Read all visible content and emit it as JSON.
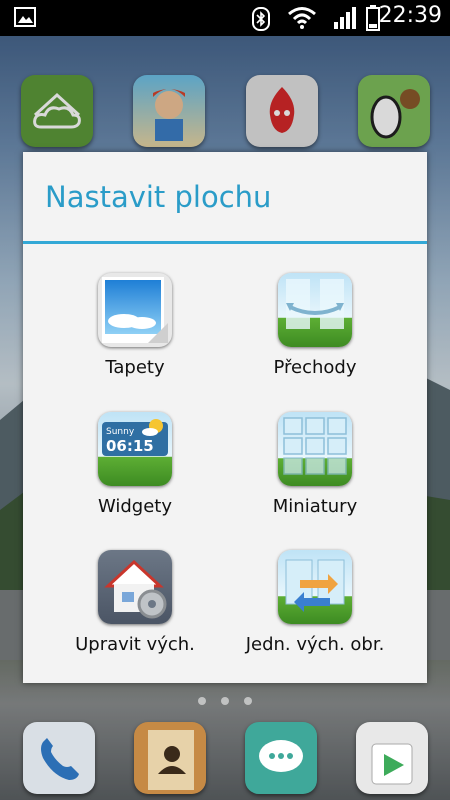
{
  "status_bar": {
    "time": "22:39",
    "icons": [
      "gallery-icon",
      "bluetooth-icon",
      "wifi-icon",
      "signal-icon",
      "battery-icon"
    ]
  },
  "home_screen": {
    "app_icons": [
      "home-cloud-icon",
      "game-boy-icon",
      "antutu-icon",
      "zebra-monkey-icon"
    ],
    "dock_icons": [
      "phone-icon",
      "contacts-icon",
      "messaging-icon",
      "play-store-icon"
    ]
  },
  "dialog": {
    "title": "Nastavit plochu",
    "options": [
      {
        "label": "Tapety",
        "icon": "wallpaper-icon"
      },
      {
        "label": "Přechody",
        "icon": "transitions-icon"
      },
      {
        "label": "Widgety",
        "icon": "widgets-icon"
      },
      {
        "label": "Miniatury",
        "icon": "thumbnails-icon"
      },
      {
        "label": "Upravit vých.",
        "icon": "edit-default-icon"
      },
      {
        "label": "Jedn. vých. obr.",
        "icon": "default-screen-icon"
      }
    ],
    "widget_preview": {
      "weather": "Sunny",
      "time": "06:15"
    }
  },
  "colors": {
    "accent": "#2a9cc8",
    "divider": "#33a8d6",
    "dialog_bg": "#f3f3f3",
    "status_bar": "#000000"
  }
}
